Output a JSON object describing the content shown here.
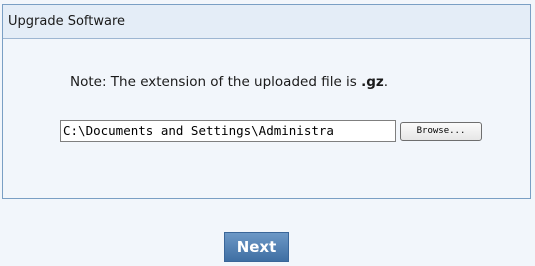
{
  "panel": {
    "title": "Upgrade Software"
  },
  "note": {
    "prefix": "Note: The extension of the uploaded file is ",
    "extension": ".gz",
    "suffix": "."
  },
  "file_upload": {
    "value": "C:\\Documents and Settings\\Administra",
    "browse_label": "Browse..."
  },
  "actions": {
    "next_label": "Next"
  },
  "colors": {
    "header_bg": "#e4edf7",
    "border": "#7a9fc4",
    "next_button": "#4f7fb3"
  }
}
